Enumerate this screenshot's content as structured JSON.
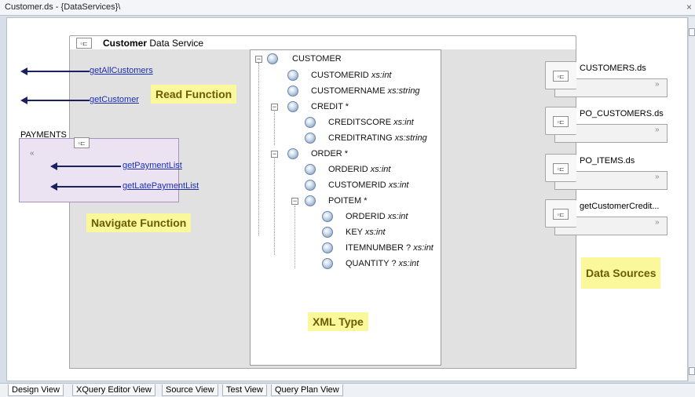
{
  "window": {
    "title": "Customer.ds - {DataServices}\\",
    "close_glyph": "×"
  },
  "data_service": {
    "name": "Customer",
    "suffix": "Data Service",
    "icon": "data-service-icon"
  },
  "read_functions": [
    "getAllCustomers",
    "getCustomer"
  ],
  "navigate": {
    "source_name": "PAYMENTS",
    "collapse_glyph": "«",
    "functions": [
      "getPaymentList",
      "getLatePaymentList"
    ]
  },
  "annotations": {
    "read": "Read Function",
    "navigate": "Navigate Function",
    "xml_type": "XML Type",
    "data_sources": "Data Sources"
  },
  "xml_tree": [
    {
      "name": "CUSTOMER",
      "type": ""
    },
    {
      "name": "CUSTOMERID",
      "type": "xs:int"
    },
    {
      "name": "CUSTOMERNAME",
      "type": "xs:string"
    },
    {
      "name": "CREDIT *",
      "type": ""
    },
    {
      "name": "CREDITSCORE",
      "type": "xs:int"
    },
    {
      "name": "CREDITRATING",
      "type": "xs:string"
    },
    {
      "name": "ORDER *",
      "type": ""
    },
    {
      "name": "ORDERID",
      "type": "xs:int"
    },
    {
      "name": "CUSTOMERID",
      "type": "xs:int"
    },
    {
      "name": "POITEM *",
      "type": ""
    },
    {
      "name": "ORDERID",
      "type": "xs:int"
    },
    {
      "name": "KEY",
      "type": "xs:int"
    },
    {
      "name": "ITEMNUMBER ?",
      "type": "xs:int"
    },
    {
      "name": "QUANTITY ?",
      "type": "xs:int"
    }
  ],
  "data_sources": [
    {
      "name": "CUSTOMERS.ds"
    },
    {
      "name": "PO_CUSTOMERS.ds"
    },
    {
      "name": "PO_ITEMS.ds"
    },
    {
      "name": "getCustomerCredit..."
    }
  ],
  "expand_glyph": "»",
  "tabs": [
    "Design View",
    "XQuery Editor View",
    "Source View",
    "Test View",
    "Query Plan View"
  ],
  "active_tab": "Design View"
}
